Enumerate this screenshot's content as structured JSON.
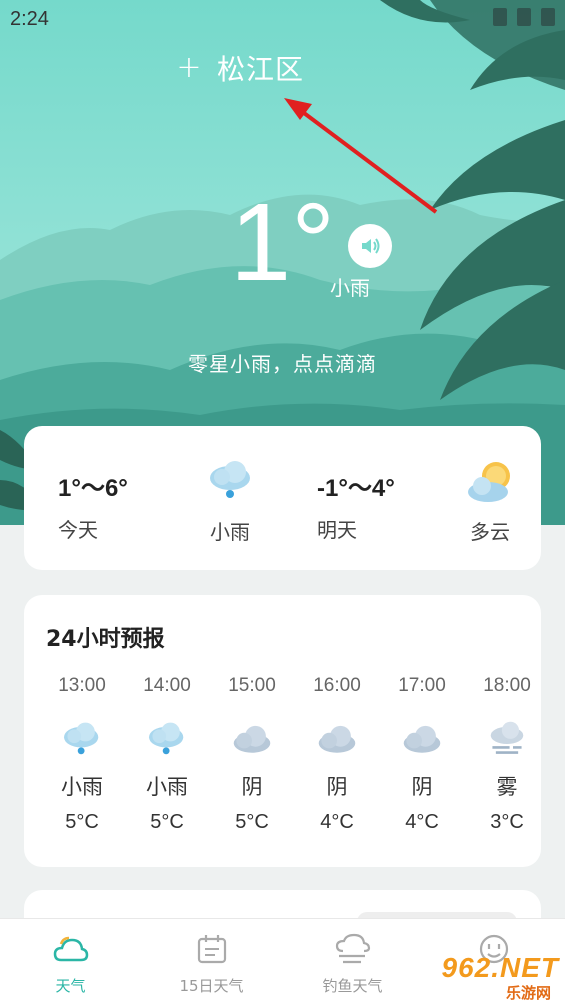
{
  "status_bar": {
    "time": "2:24"
  },
  "header": {
    "add_icon": "+",
    "location": "松江区"
  },
  "current": {
    "temperature": "1°",
    "condition": "小雨",
    "description": "零星小雨，点点滴滴"
  },
  "summary": {
    "today": {
      "temp_range": "1°～6°",
      "label": "今天",
      "condition": "小雨",
      "icon": "rain-cloud-icon"
    },
    "tomorrow": {
      "temp_range": "-1°～4°",
      "label": "明天",
      "condition": "多云",
      "icon": "partly-cloudy-icon"
    }
  },
  "hourly": {
    "title": "24小时预报",
    "items": [
      {
        "time": "13:00",
        "condition": "小雨",
        "temp": "5°C",
        "icon": "rain-cloud-icon"
      },
      {
        "time": "14:00",
        "condition": "小雨",
        "temp": "5°C",
        "icon": "rain-cloud-icon"
      },
      {
        "time": "15:00",
        "condition": "阴",
        "temp": "5°C",
        "icon": "overcast-cloud-icon"
      },
      {
        "time": "16:00",
        "condition": "阴",
        "temp": "4°C",
        "icon": "overcast-cloud-icon"
      },
      {
        "time": "17:00",
        "condition": "阴",
        "temp": "4°C",
        "icon": "overcast-cloud-icon"
      },
      {
        "time": "18:00",
        "condition": "雾",
        "temp": "3°C",
        "icon": "fog-icon"
      }
    ]
  },
  "tabbar": {
    "items": [
      {
        "label": "天气",
        "icon": "weather-cloud-icon",
        "active": true
      },
      {
        "label": "15日天气",
        "icon": "calendar-icon",
        "active": false
      },
      {
        "label": "钓鱼天气",
        "icon": "fishing-weather-icon",
        "active": false
      },
      {
        "label": "",
        "icon": "smiley-icon",
        "active": false
      }
    ]
  },
  "watermark": {
    "text": "962.NET",
    "sub": "乐游网"
  },
  "colors": {
    "accent": "#2bb6a6",
    "annotation_arrow": "#e02020"
  }
}
